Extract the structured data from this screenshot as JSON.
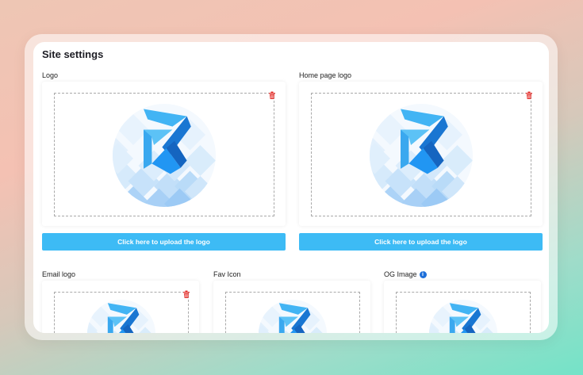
{
  "page": {
    "title": "Site settings"
  },
  "sections": {
    "logo": {
      "label": "Logo",
      "upload_label": "Click here to upload the logo"
    },
    "home_page_logo": {
      "label": "Home page logo",
      "upload_label": "Click here to upload the logo"
    },
    "email_logo": {
      "label": "Email logo"
    },
    "fav_icon": {
      "label": "Fav Icon"
    },
    "og_image": {
      "label": "OG Image",
      "info_icon": "info-icon"
    }
  },
  "colors": {
    "accent": "#3dbbf5",
    "delete": "#e53935",
    "logo_light": "#4fc3f7",
    "logo_dark": "#1565c0"
  },
  "icons": {
    "delete": "trash-icon",
    "info": "info-icon"
  }
}
